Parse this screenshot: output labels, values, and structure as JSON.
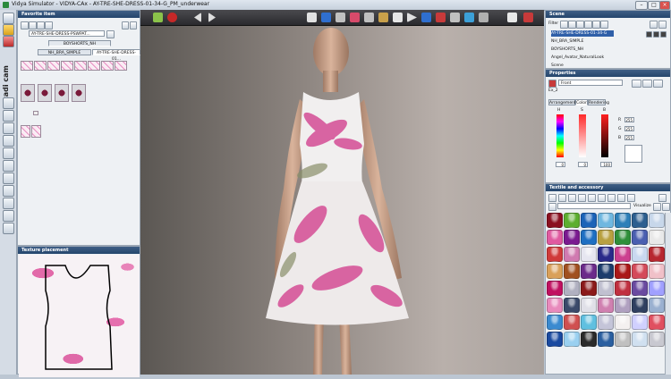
{
  "window": {
    "title": "Vidya Simulator - VIDYA-CAx - AY-TRE-SHE-DRESS-01-34-G_PM_underwear"
  },
  "left_strip": {
    "brand": "cadi cam"
  },
  "favorites": {
    "header": "Favorite item",
    "select_value": "AY-TRE-SHE-DRESS-PSWPAT...",
    "garment_button": "BOYSHORTS_NH",
    "tabs": [
      "NH_BRA_SIMPLE",
      "AY-TRE-SHE-DRESS-01..."
    ]
  },
  "texture_placement": {
    "header": "Texture placement"
  },
  "scene": {
    "header": "Scene",
    "filter_label": "Filter",
    "items": [
      {
        "label": "AY-TRE-SHE-DRESS-01-34-G",
        "selected": true
      },
      {
        "label": "NH_BRA_SIMPLE",
        "selected": false
      },
      {
        "label": "BOYSHORTS_NH",
        "selected": false
      },
      {
        "label": "Angel_Avatar_NaturalLook",
        "selected": false
      },
      {
        "label": "Scene",
        "selected": false
      }
    ]
  },
  "properties": {
    "header": "Properties",
    "side_select": "Front",
    "item_label": "Ex_2",
    "tabs": [
      "Arrangement",
      "Color",
      "Rendering"
    ],
    "active_tab": "Color",
    "h_label": "H",
    "s_label": "S",
    "b_label": "B",
    "r_label": "R",
    "g_label": "G",
    "b2_label": "B",
    "r_value": "255",
    "g_value": "255",
    "b_value": "255",
    "h_value": "0",
    "s_value": "0",
    "bright_value": "100"
  },
  "library": {
    "header": "Textile and accessory",
    "visualize_label": "Visualize",
    "swatch_colors": [
      "#8a1020",
      "#5cae2f",
      "#1b63b8",
      "#6fb7e0",
      "#2d7fb8",
      "#2d5f8f",
      "#c7d7ea",
      "#e05aa0",
      "#7a1a90",
      "#1e6fc2",
      "#b8a040",
      "#2f8f3a",
      "#4a5fb0",
      "#e8e8e8",
      "#d03a3a",
      "#d07ab0",
      "#e6e6f0",
      "#2a2a8a",
      "#cc3f8f",
      "#c9d8f0",
      "#b7272f",
      "#d9a05a",
      "#a05020",
      "#6b2a8a",
      "#1c3c6c",
      "#aa1818",
      "#d44a5a",
      "#f0c0c8",
      "#c01060",
      "#b0b0c0",
      "#8b1a1a",
      "#c0c0d0",
      "#c03040",
      "#6a4aa0",
      "#a0a0ff",
      "#e88abc",
      "#3a4a6a",
      "#e0e0e8",
      "#d080b0",
      "#b0a0c0",
      "#304060",
      "#9ab0d0",
      "#3a8ad0",
      "#d05050",
      "#60c0e0",
      "#c4c4d8",
      "#f4f0f0",
      "#d0d0ff",
      "#e05060",
      "#1a4aa0",
      "#9ad0f0",
      "#2a2a2a",
      "#2a5fa0",
      "#c0c0c0",
      "#d0e0f0",
      "#c8c8d0"
    ]
  }
}
